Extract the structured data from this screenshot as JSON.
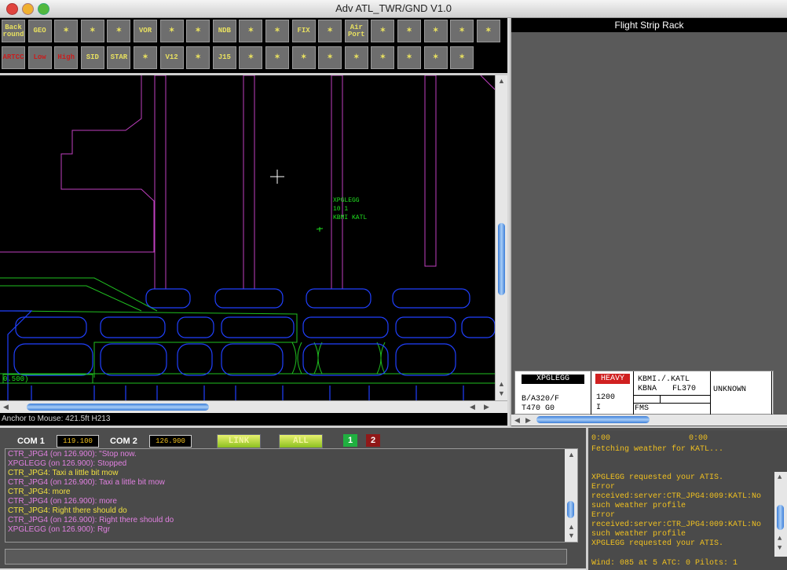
{
  "window": {
    "title": "Adv ATL_TWR/GND V1.0"
  },
  "toolbar": {
    "row1": [
      {
        "label": "Back\nround",
        "icon": ""
      },
      {
        "label": "GEO",
        "icon": ""
      },
      {
        "label": "",
        "icon": "target-rings-icon"
      },
      {
        "label": "",
        "icon": "crosshair-icon"
      },
      {
        "label": "",
        "icon": "circle-icon"
      },
      {
        "label": "VOR",
        "icon": ""
      },
      {
        "label": "",
        "icon": "tower-icon"
      },
      {
        "label": "",
        "icon": "ndb-circle-icon"
      },
      {
        "label": "NDB",
        "icon": ""
      },
      {
        "label": "",
        "icon": "tower-icon"
      },
      {
        "label": "",
        "icon": "triangle-icon"
      },
      {
        "label": "FIX",
        "icon": ""
      },
      {
        "label": "",
        "icon": "runway-light-icon"
      },
      {
        "label": "Air\nPort",
        "icon": ""
      },
      {
        "label": "",
        "icon": "tower-icon"
      },
      {
        "label": "",
        "icon": "lifebuoy-icon"
      },
      {
        "label": "",
        "icon": "runway-icon"
      },
      {
        "label": "",
        "icon": "runway-lights-icon"
      },
      {
        "label": "",
        "icon": "taxiway-icon"
      }
    ],
    "row2": [
      {
        "label": "ARTCC",
        "icon": ""
      },
      {
        "label": "Low",
        "icon": ""
      },
      {
        "label": "High",
        "icon": ""
      },
      {
        "label": "SID",
        "icon": ""
      },
      {
        "label": "STAR",
        "icon": ""
      },
      {
        "label": "",
        "icon": "airway-x-icon"
      },
      {
        "label": "V12",
        "icon": ""
      },
      {
        "label": "",
        "icon": "airway-x-icon"
      },
      {
        "label": "J15",
        "icon": ""
      },
      {
        "label": "",
        "icon": "plane-icon"
      },
      {
        "label": "",
        "icon": "plane-cursor-icon"
      },
      {
        "label": "",
        "icon": "plane-icon"
      },
      {
        "label": "",
        "icon": "plane-label-icon"
      },
      {
        "label": "",
        "icon": "plane-track-icon"
      },
      {
        "label": "",
        "icon": "plane-red-icon"
      },
      {
        "label": "",
        "icon": "plane-question-icon"
      },
      {
        "label": "",
        "icon": "plane-check-icon"
      },
      {
        "label": "",
        "icon": "plane-help-icon"
      }
    ]
  },
  "radar": {
    "target": {
      "callsign": "XPGLEGG",
      "line2": "10 1",
      "route": "KBMI KATL"
    },
    "range_label": "0.500)"
  },
  "status": {
    "anchor": "Anchor to Mouse: 421.5ft H213"
  },
  "strip_rack": {
    "title": "Flight Strip Rack",
    "strip": {
      "callsign": "XPGLEGG",
      "type": "B/A320/F",
      "extra": "T470 G0",
      "weight": "HEAVY",
      "code": "1200",
      "rules": "I",
      "route1": "KBMI./.KATL",
      "route2": "KBNA",
      "alt": "FL370",
      "fms": "FMS",
      "status": "UNKNOWN"
    }
  },
  "comms": {
    "com1_label": "COM 1",
    "com1_freq": "119.100",
    "com2_label": "COM 2",
    "com2_freq": "126.900",
    "link_label": "LINK",
    "all_label": "ALL",
    "ch1": "1",
    "ch2": "2",
    "messages": [
      {
        "text": "CTR_JPG4 (on 126.900): \"Stop now.",
        "color": "#e080e0"
      },
      {
        "text": "XPGLEGG (on 126.900): Stopped",
        "color": "#e080e0"
      },
      {
        "text": "CTR_JPG4: Taxi a little bit mow",
        "color": "#f0e040"
      },
      {
        "text": "CTR_JPG4 (on 126.900): Taxi a little bit mow",
        "color": "#e080e0"
      },
      {
        "text": "CTR_JPG4: more",
        "color": "#f0e040"
      },
      {
        "text": "CTR_JPG4 (on 126.900): more",
        "color": "#e080e0"
      },
      {
        "text": "CTR_JPG4: Right there should do",
        "color": "#f0e040"
      },
      {
        "text": "CTR_JPG4 (on 126.900): Right there should do",
        "color": "#e080e0"
      },
      {
        "text": "XPGLEGG (on 126.900): Rgr",
        "color": "#e080e0"
      }
    ]
  },
  "weather": {
    "time_left": "0:00",
    "time_right": "0:00",
    "lines": [
      "Fetching weather for KATL...",
      "",
      "",
      "XPGLEGG requested your ATIS.",
      "Error",
      "received:server:CTR_JPG4:009:KATL:No",
      "such weather profile",
      "Error",
      "received:server:CTR_JPG4:009:KATL:No",
      "such weather profile",
      "XPGLEGG requested your ATIS."
    ],
    "footer": "Wind: 085 at 5   ATC: 0 Pilots: 1"
  }
}
